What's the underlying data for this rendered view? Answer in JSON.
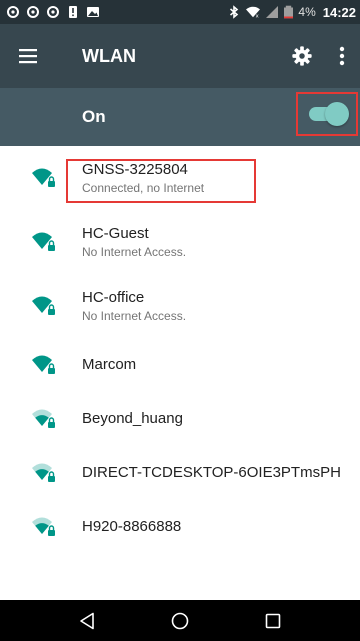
{
  "status_bar": {
    "battery_percent": "4%",
    "time": "14:22",
    "icons": [
      "notification-icon",
      "notification-icon",
      "notification-icon",
      "alert-icon",
      "image-icon",
      "bluetooth-icon",
      "wifi-icon",
      "no-signal-icon",
      "battery-icon"
    ]
  },
  "app_bar": {
    "title": "WLAN",
    "icons": [
      "menu-icon",
      "gear-icon",
      "more-vert-icon"
    ]
  },
  "wifi_toggle": {
    "label": "On",
    "state": "on"
  },
  "networks": [
    {
      "name": "GNSS-3225804",
      "status": "Connected, no Internet",
      "signal": "full",
      "secured": true
    },
    {
      "name": "HC-Guest",
      "status": "No Internet Access.",
      "signal": "full",
      "secured": true
    },
    {
      "name": "HC-office",
      "status": "No Internet Access.",
      "signal": "full",
      "secured": true
    },
    {
      "name": "Marcom",
      "status": "",
      "signal": "full",
      "secured": true
    },
    {
      "name": "Beyond_huang",
      "status": "",
      "signal": "medium",
      "secured": true
    },
    {
      "name": "DIRECT-TCDESKTOP-6OIE3PTmsPH",
      "status": "",
      "signal": "medium",
      "secured": true
    },
    {
      "name": "H920-8866888",
      "status": "",
      "signal": "medium",
      "secured": true
    }
  ],
  "nav_bar": {
    "icons": [
      "back-icon",
      "home-icon",
      "recents-icon"
    ]
  },
  "colors": {
    "status_bar": "#263238",
    "app_bar": "#37474f",
    "toggle_bar": "#455a64",
    "accent": "#009688",
    "highlight": "#e53935"
  }
}
